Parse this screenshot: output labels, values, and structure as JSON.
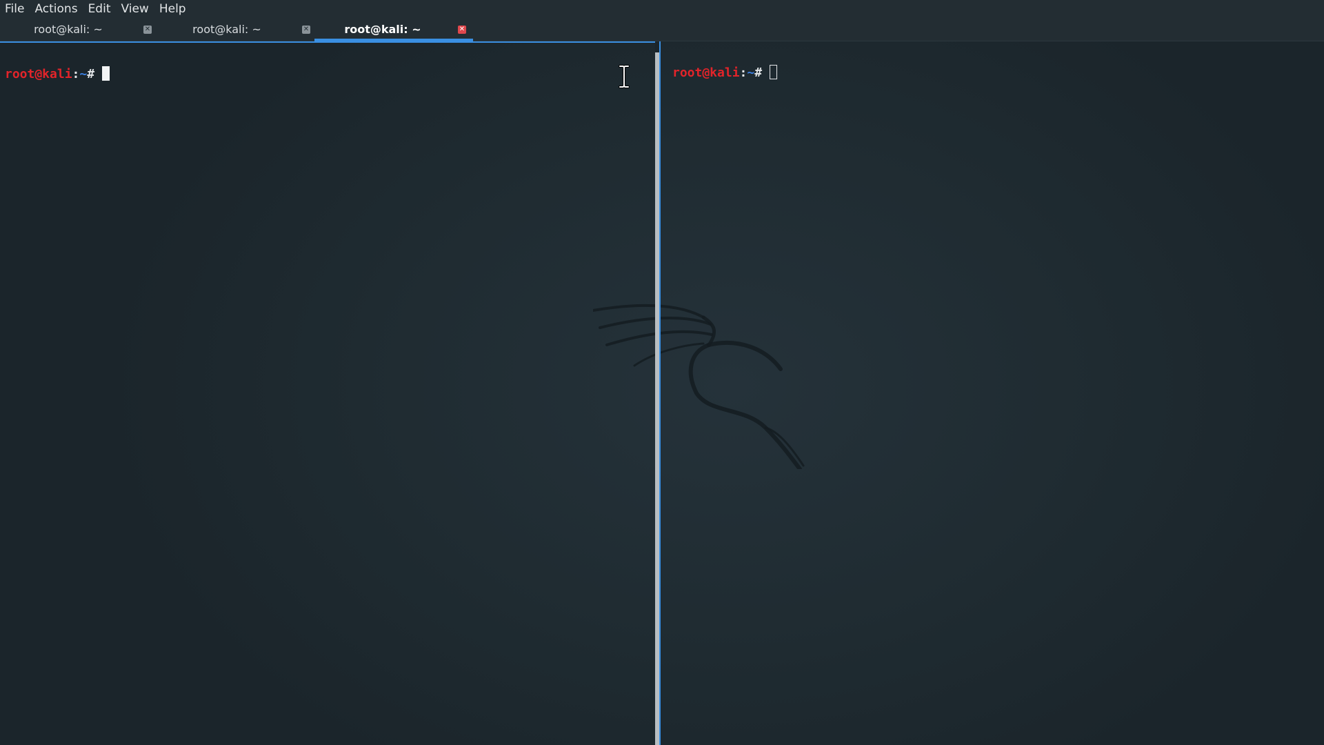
{
  "menubar": {
    "items": [
      {
        "label": "File"
      },
      {
        "label": "Actions"
      },
      {
        "label": "Edit"
      },
      {
        "label": "View"
      },
      {
        "label": "Help"
      }
    ]
  },
  "tabs": [
    {
      "label": "root@kali: ~",
      "active": false,
      "close_icon": "close-icon"
    },
    {
      "label": "root@kali: ~",
      "active": false,
      "close_icon": "close-icon"
    },
    {
      "label": "root@kali: ~",
      "active": true,
      "close_icon": "close-icon"
    }
  ],
  "panes": {
    "left": {
      "prompt": {
        "user": "root@kali",
        "sep": ":",
        "path": "~",
        "hash": "#"
      },
      "cursor": "block",
      "focused": true
    },
    "right": {
      "prompt": {
        "user": "root@kali",
        "sep": ":",
        "path": "~",
        "hash": "#"
      },
      "cursor": "hollow",
      "focused": false
    }
  },
  "colors": {
    "accent": "#3a8fe2",
    "prompt_user": "#e2242a",
    "prompt_path": "#3b7fe0",
    "background": "#1f2a30",
    "tab_close_active": "#e0474c"
  },
  "icons": {
    "mouse_cursor": "text-cursor-icon",
    "background_logo": "kali-dragon-icon"
  }
}
